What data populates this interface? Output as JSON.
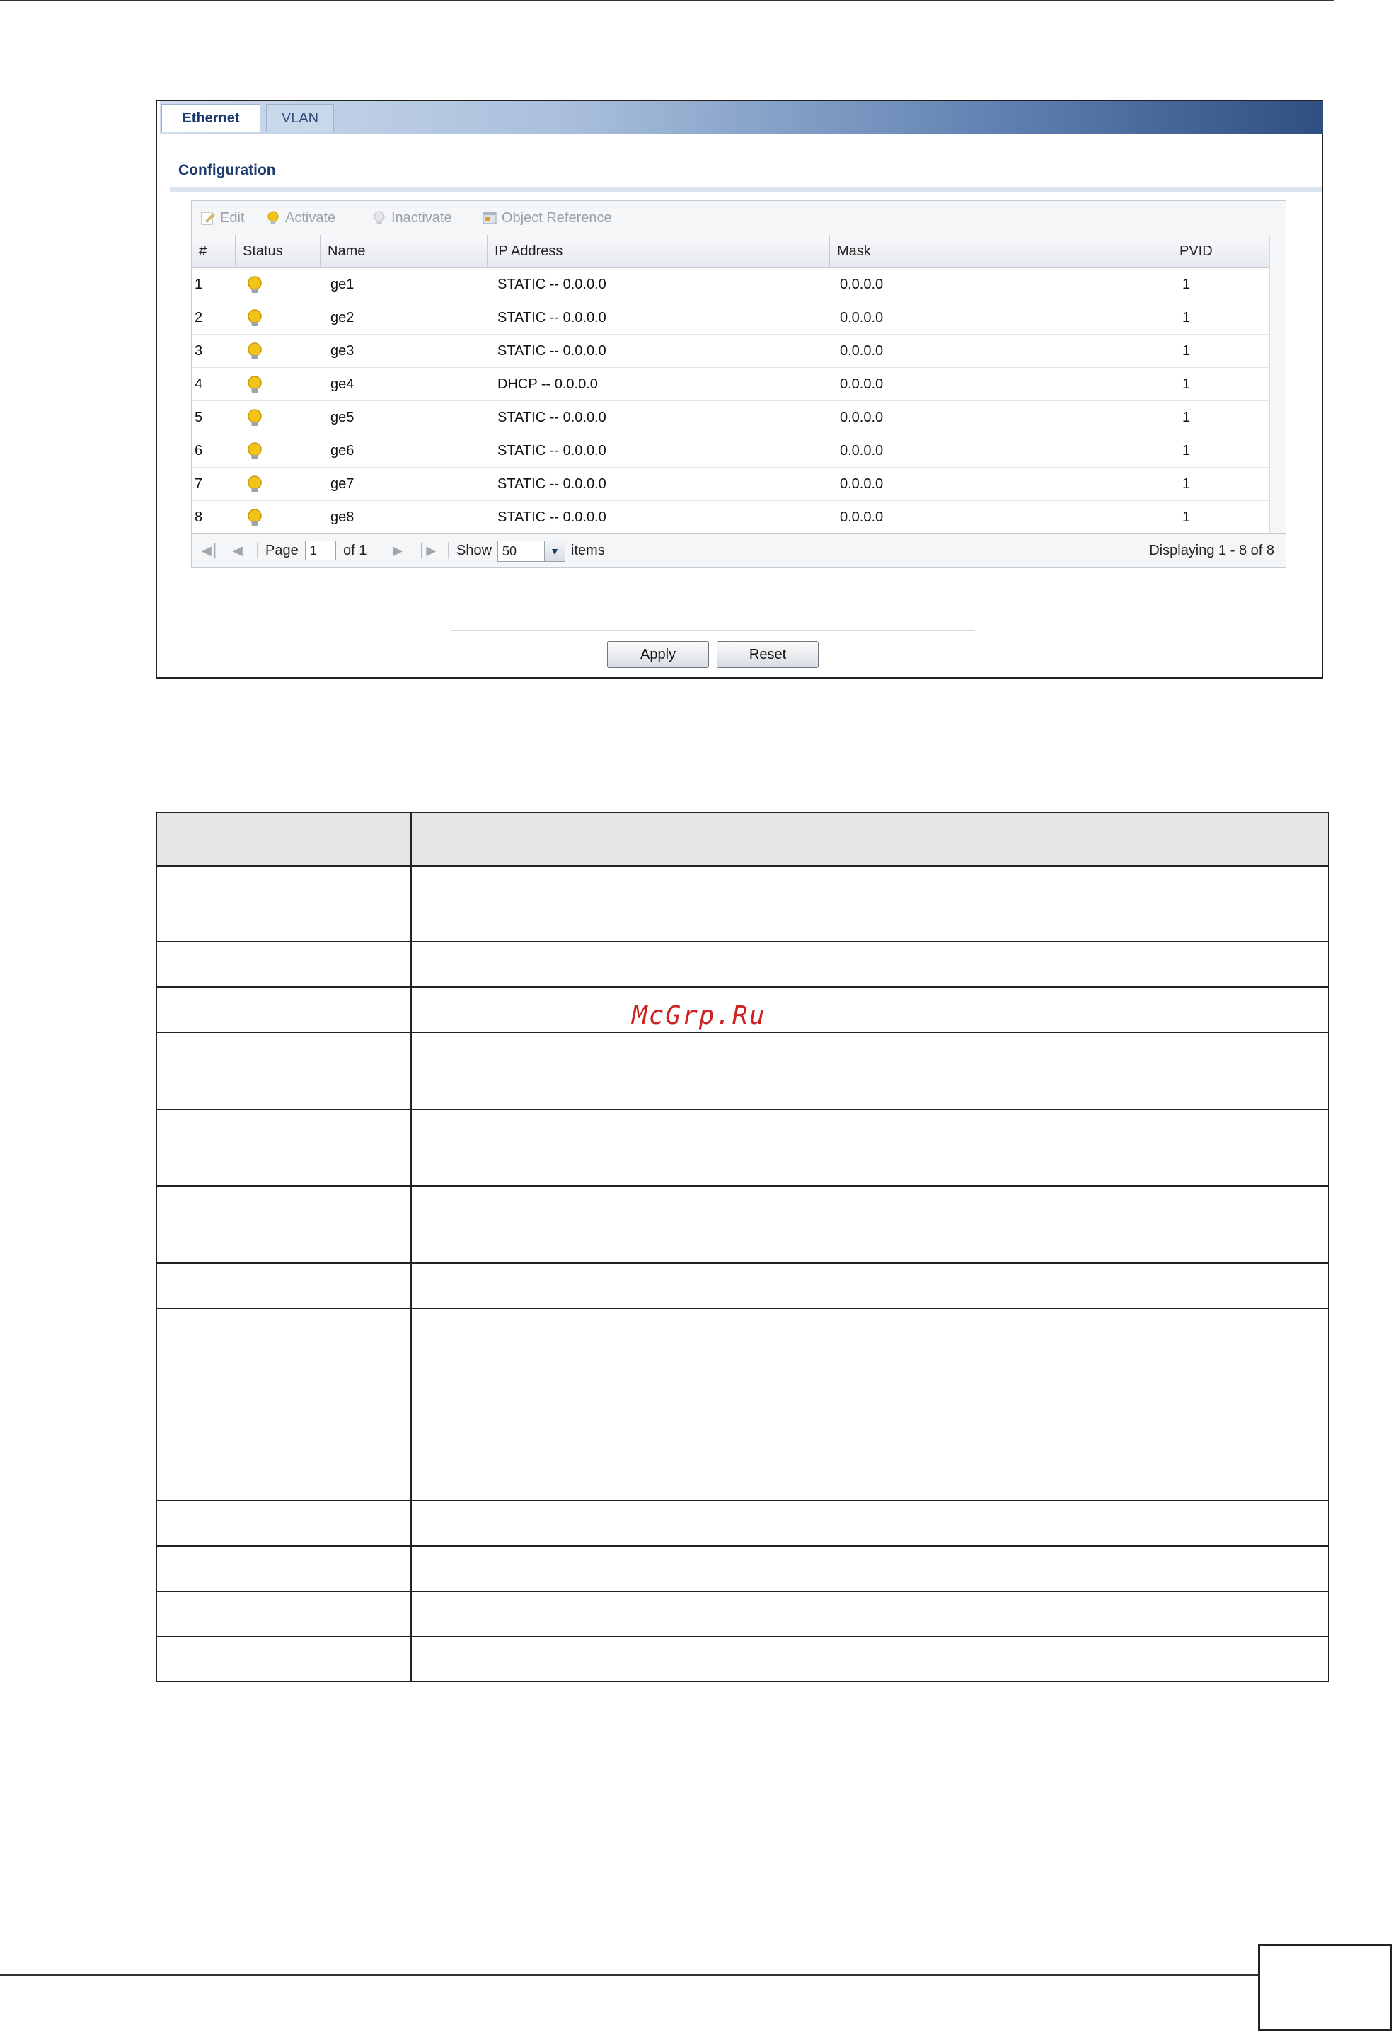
{
  "tabs": [
    {
      "label": "Ethernet",
      "active": true
    },
    {
      "label": "VLAN",
      "active": false
    }
  ],
  "section_title": "Configuration",
  "toolbar": {
    "edit": "Edit",
    "activate": "Activate",
    "inactivate": "Inactivate",
    "object_reference": "Object Reference"
  },
  "columns": [
    "#",
    "Status",
    "Name",
    "IP Address",
    "Mask",
    "PVID"
  ],
  "rows": [
    {
      "num": "1",
      "name": "ge1",
      "ip": "STATIC -- 0.0.0.0",
      "mask": "0.0.0.0",
      "pvid": "1"
    },
    {
      "num": "2",
      "name": "ge2",
      "ip": "STATIC -- 0.0.0.0",
      "mask": "0.0.0.0",
      "pvid": "1"
    },
    {
      "num": "3",
      "name": "ge3",
      "ip": "STATIC -- 0.0.0.0",
      "mask": "0.0.0.0",
      "pvid": "1"
    },
    {
      "num": "4",
      "name": "ge4",
      "ip": "DHCP -- 0.0.0.0",
      "mask": "0.0.0.0",
      "pvid": "1"
    },
    {
      "num": "5",
      "name": "ge5",
      "ip": "STATIC -- 0.0.0.0",
      "mask": "0.0.0.0",
      "pvid": "1"
    },
    {
      "num": "6",
      "name": "ge6",
      "ip": "STATIC -- 0.0.0.0",
      "mask": "0.0.0.0",
      "pvid": "1"
    },
    {
      "num": "7",
      "name": "ge7",
      "ip": "STATIC -- 0.0.0.0",
      "mask": "0.0.0.0",
      "pvid": "1"
    },
    {
      "num": "8",
      "name": "ge8",
      "ip": "STATIC -- 0.0.0.0",
      "mask": "0.0.0.0",
      "pvid": "1"
    }
  ],
  "pager": {
    "page_label": "Page",
    "page_value": "1",
    "of_label": "of 1",
    "show_label": "Show",
    "show_value": "50",
    "items_label": "items",
    "displaying": "Displaying 1 - 8 of 8"
  },
  "buttons": {
    "apply": "Apply",
    "reset": "Reset"
  },
  "watermark": "McGrp.Ru",
  "colors": {
    "bulb": "#f2c318",
    "header_blue": "#1b3a6d",
    "watermark": "#cc2222"
  }
}
